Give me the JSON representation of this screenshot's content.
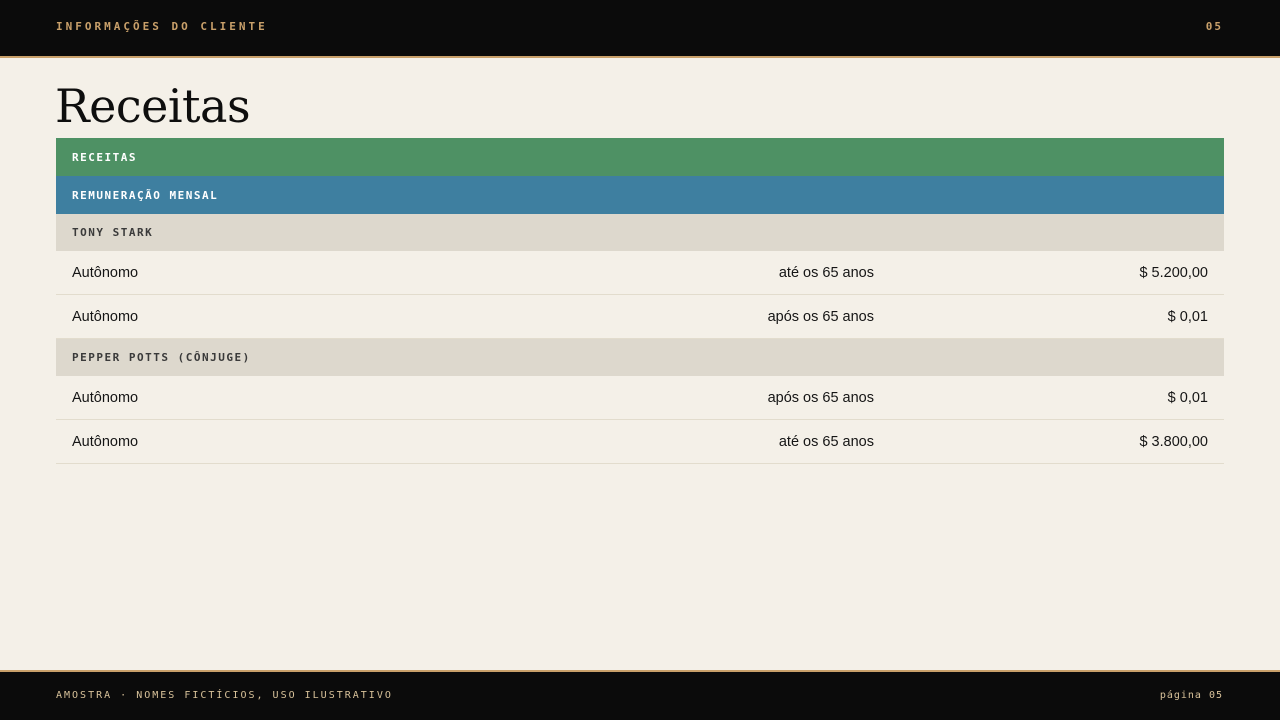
{
  "header": {
    "section": "INFORMAÇÕES DO CLIENTE",
    "number": "05"
  },
  "title": "Receitas",
  "table": {
    "category": "RECEITAS",
    "subcategory": "REMUNERAÇÃO MENSAL",
    "groups": [
      {
        "person": "TONY STARK",
        "rows": [
          {
            "type": "Autônomo",
            "period": "até os 65 anos",
            "value": "$ 5.200,00"
          },
          {
            "type": "Autônomo",
            "period": "após os 65 anos",
            "value": "$ 0,01"
          }
        ]
      },
      {
        "person": "PEPPER POTTS (CÔNJUGE)",
        "rows": [
          {
            "type": "Autônomo",
            "period": "após os 65 anos",
            "value": "$ 0,01"
          },
          {
            "type": "Autônomo",
            "period": "até os 65 anos",
            "value": "$ 3.800,00"
          }
        ]
      }
    ]
  },
  "footer": {
    "note": "AMOSTRA · NOMES FICTÍCIOS, USO ILUSTRATIVO",
    "page": "página 05"
  },
  "colors": {
    "accent": "#c9a06a",
    "category_band": "#4e9164",
    "subcategory_band": "#3e7fa0",
    "person_band": "#ddd8cd",
    "background": "#f4f0e8"
  }
}
